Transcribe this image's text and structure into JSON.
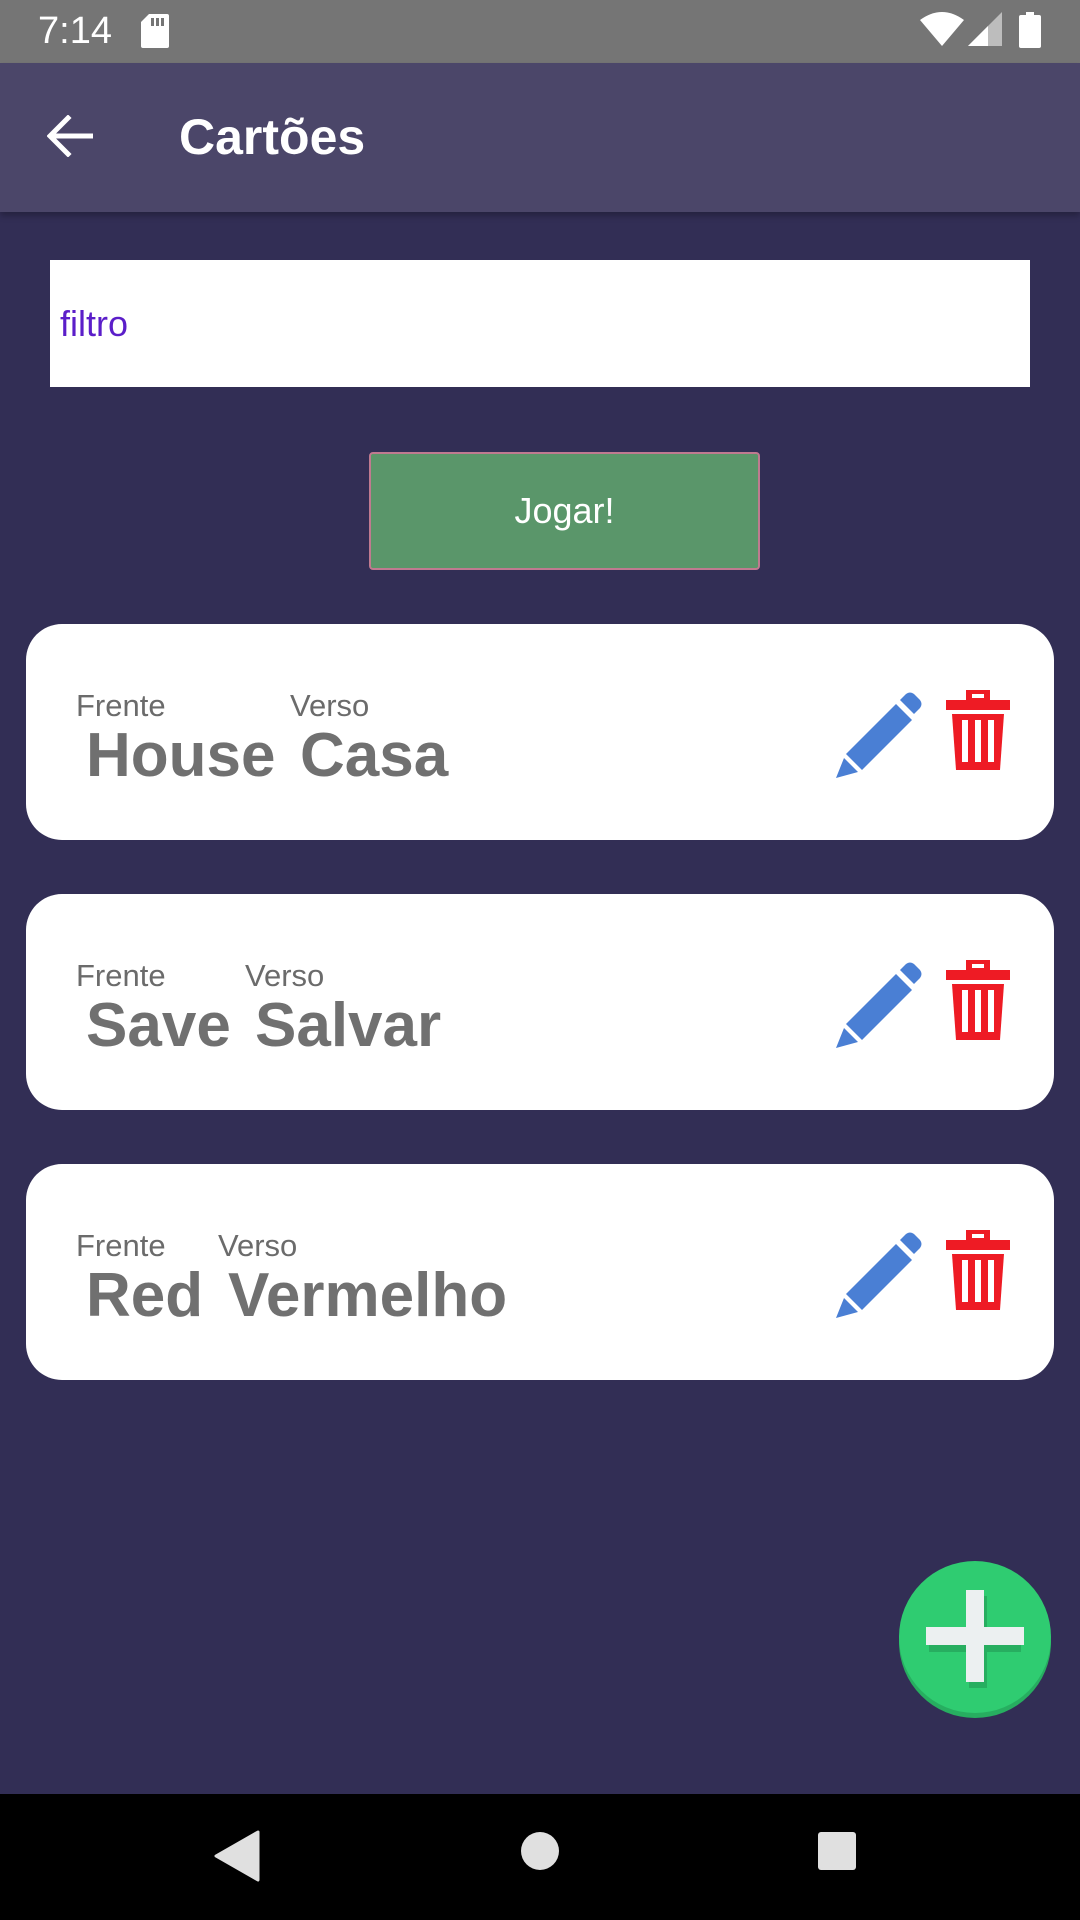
{
  "status_bar": {
    "time": "7:14",
    "icons": [
      "sd-card-icon",
      "wifi-icon",
      "signal-icon",
      "battery-icon"
    ]
  },
  "app_bar": {
    "title": "Cartões",
    "back_icon": "arrow-left-icon"
  },
  "filter": {
    "placeholder": "filtro",
    "value": ""
  },
  "play_button": {
    "label": "Jogar!"
  },
  "cards": [
    {
      "front_label": "Frente",
      "back_label": "Verso",
      "front": "House",
      "back": "Casa"
    },
    {
      "front_label": "Frente",
      "back_label": "Verso",
      "front": "Save",
      "back": "Salvar"
    },
    {
      "front_label": "Frente",
      "back_label": "Verso",
      "front": "Red",
      "back": "Vermelho"
    }
  ],
  "card_actions": {
    "edit_icon": "pencil-icon",
    "delete_icon": "trash-icon"
  },
  "fab": {
    "icon": "plus-icon"
  },
  "colors": {
    "background": "#322e55",
    "app_bar": "#4b4669",
    "play_button": "#5a966a",
    "edit": "#4a7fd4",
    "delete": "#ee1b24",
    "fab": "#2fcc71",
    "filter_text": "#5b1ec9"
  }
}
